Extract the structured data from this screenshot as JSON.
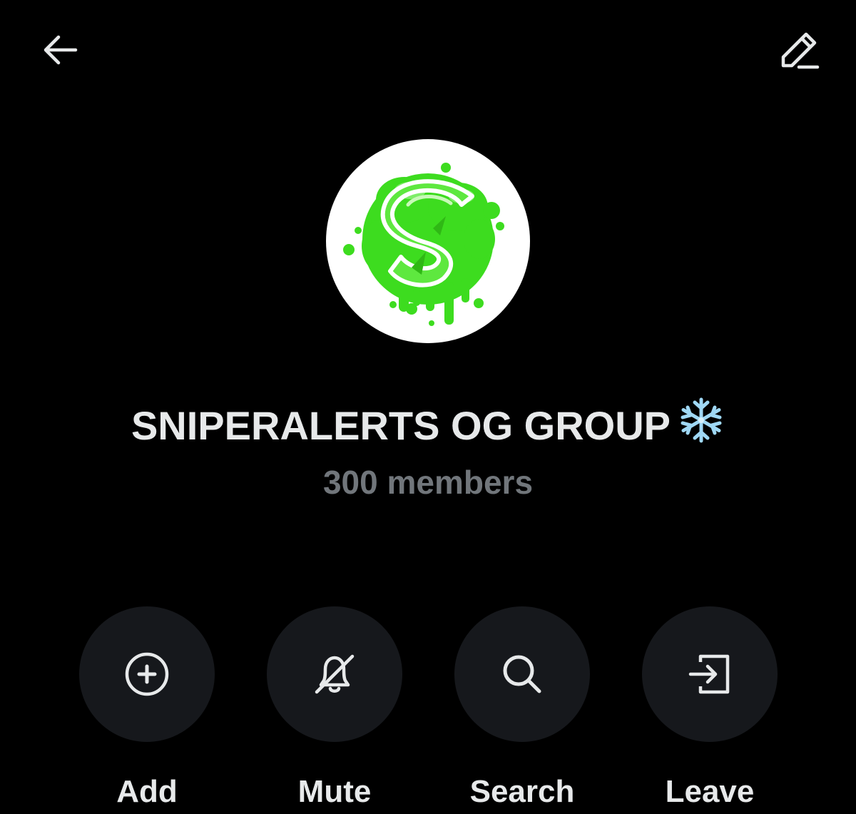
{
  "header": {
    "back_icon": "arrow-left-icon",
    "edit_icon": "pencil-icon"
  },
  "group": {
    "name": "SNIPERALERTS OG GROUP",
    "emoji_icon": "snowflake-icon",
    "members_label": "300 members",
    "avatar_icon": "green-s-slime-logo",
    "accent_color": "#3ddc1f"
  },
  "actions": [
    {
      "label": "Add",
      "icon": "plus-circle-icon"
    },
    {
      "label": "Mute",
      "icon": "bell-off-icon"
    },
    {
      "label": "Search",
      "icon": "search-icon"
    },
    {
      "label": "Leave",
      "icon": "exit-icon"
    }
  ],
  "colors": {
    "background": "#000000",
    "button_bg": "#16181c",
    "text_primary": "#e7e9ea",
    "text_secondary": "#71767b"
  }
}
